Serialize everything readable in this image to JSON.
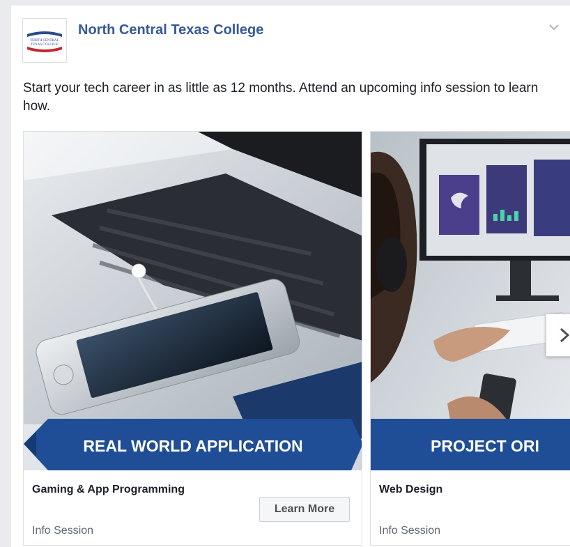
{
  "page": {
    "name": "North Central Texas College",
    "logo_text_line1": "NORTH CENTRAL",
    "logo_text_line2": "TEXAS COLLEGE"
  },
  "post": {
    "text": "Start your tech career in as little as 12 months. Attend an upcoming info session to learn how."
  },
  "carousel": {
    "items": [
      {
        "banner": "REAL WORLD APPLICATION",
        "title": "Gaming & App Programming",
        "subtitle": "Info Session",
        "cta": "Learn More"
      },
      {
        "banner": "PROJECT ORI",
        "title": "Web Design",
        "subtitle": "Info Session"
      }
    ]
  },
  "colors": {
    "link_blue": "#365899",
    "banner_blue": "#1f4e96",
    "background": "#e9ebee"
  },
  "icons": {
    "menu": "chevron-down-icon",
    "next": "chevron-right-icon"
  }
}
